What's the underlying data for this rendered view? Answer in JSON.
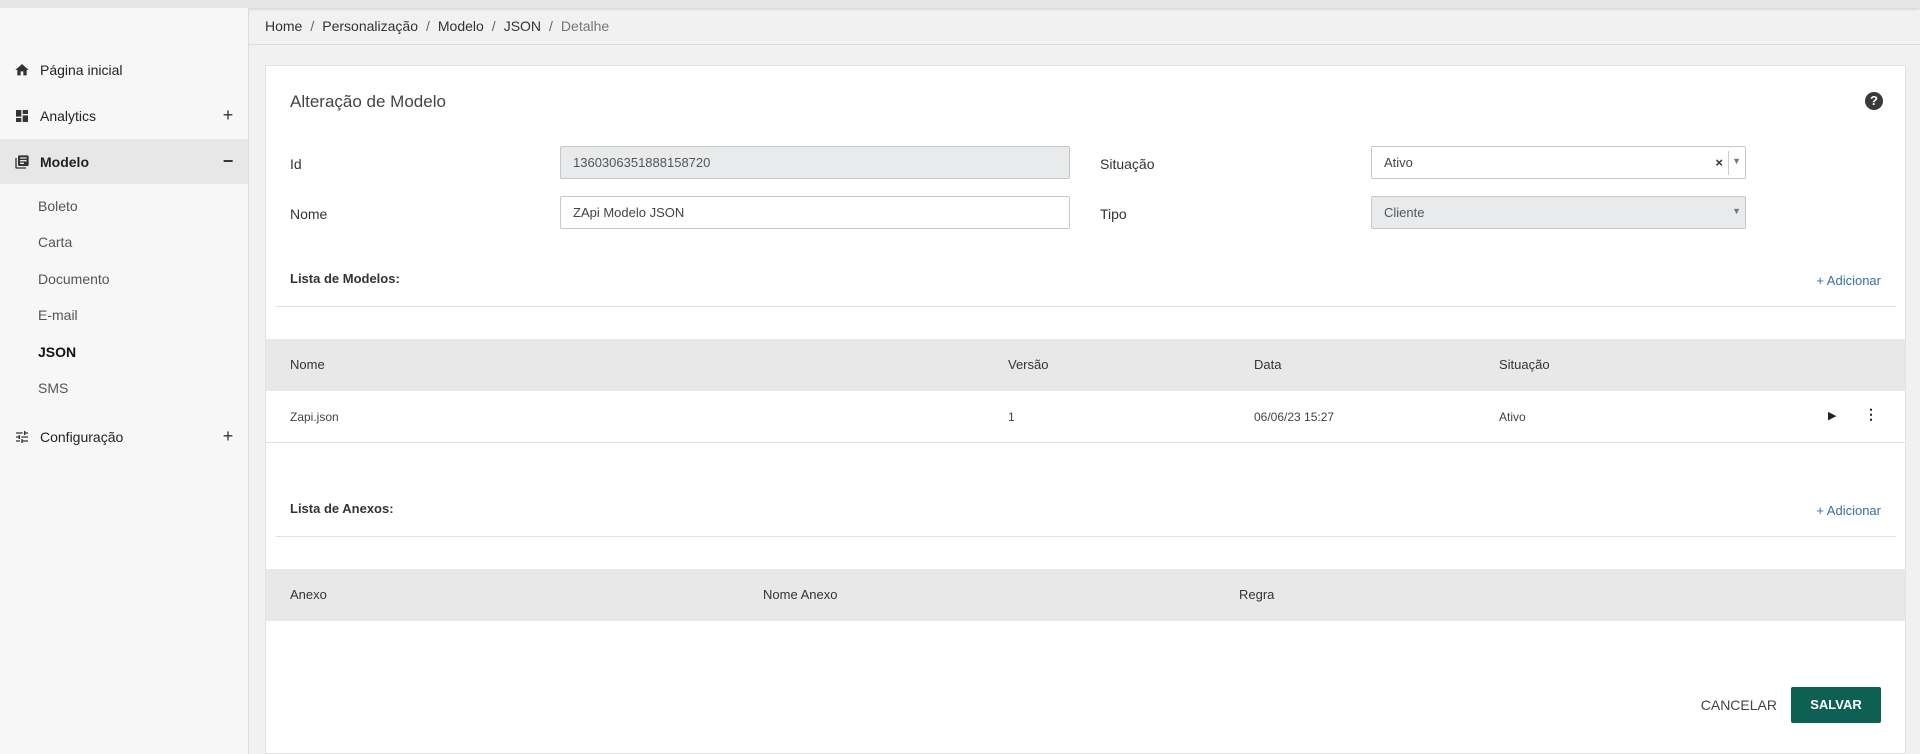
{
  "sidebar": {
    "items": [
      {
        "label": "Página inicial",
        "icon": "home-icon"
      },
      {
        "label": "Analytics",
        "icon": "dashboard-icon",
        "toggle": "+"
      },
      {
        "label": "Modelo",
        "icon": "library-icon",
        "toggle": "−"
      },
      {
        "label": "Configuração",
        "icon": "tune-icon",
        "toggle": "+"
      }
    ],
    "sub_items": [
      "Boleto",
      "Carta",
      "Documento",
      "E-mail",
      "JSON",
      "SMS"
    ]
  },
  "breadcrumb": [
    "Home",
    "Personalização",
    "Modelo",
    "JSON",
    "Detalhe"
  ],
  "form": {
    "title": "Alteração de Modelo",
    "help_icon": "?",
    "id_label": "Id",
    "id_value": "1360306351888158720",
    "name_label": "Nome",
    "name_value": "ZApi Modelo JSON",
    "status_label": "Situação",
    "status_value": "Ativo",
    "type_label": "Tipo",
    "type_value": "Cliente"
  },
  "models": {
    "title": "Lista de Modelos:",
    "add_label": "+ Adicionar",
    "columns": [
      "Nome",
      "Versão",
      "Data",
      "Situação"
    ],
    "rows": [
      {
        "nome": "Zapi.json",
        "versao": "1",
        "data": "06/06/23 15:27",
        "situacao": "Ativo"
      }
    ]
  },
  "attachments": {
    "title": "Lista de Anexos:",
    "add_label": "+ Adicionar",
    "columns": [
      "Anexo",
      "Nome Anexo",
      "Regra"
    ]
  },
  "actions": {
    "cancel": "CANCELAR",
    "save": "SALVAR"
  },
  "colors": {
    "primary": "#0e6152",
    "link": "#3a6ea5"
  }
}
